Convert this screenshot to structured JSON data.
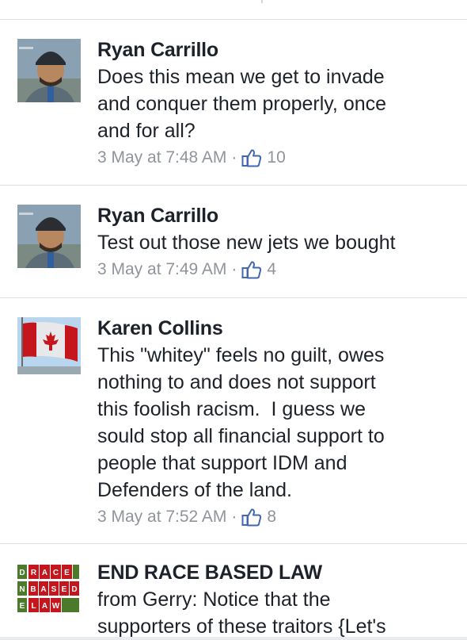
{
  "comments": [
    {
      "name": "Ryan Carrillo",
      "text": "Does this mean we get to invade\nand conquer them properly, once\nand for all?",
      "time": "3 May at 7:48 AM",
      "sep": "·",
      "likes": "10",
      "avatar": "man-beanie-avatar"
    },
    {
      "name": "Ryan Carrillo",
      "text": "Test out those new jets we bought",
      "time": "3 May at 7:49 AM",
      "sep": "·",
      "likes": "4",
      "avatar": "man-beanie-avatar"
    },
    {
      "name": "Karen Collins",
      "text": "This \"whitey\" feels no guilt, owes\nnothing to and does not support\nthis foolish racism.  I guess we\nsould stop all financial support to\npeople that support IDM and\nDefenders of the land.",
      "time": "3 May at 7:52 AM",
      "sep": "·",
      "likes": "8",
      "avatar": "canada-flag-avatar"
    },
    {
      "name": "END RACE BASED LAW",
      "text": "from Gerry: Notice that the\nsupporters of these traitors {Let's",
      "avatar": "end-race-based-law-logo",
      "logo": {
        "col": [
          "E",
          "N",
          "D"
        ],
        "row1": [
          "R",
          "A",
          "C",
          "E"
        ],
        "row2": [
          "B",
          "A",
          "S",
          "E",
          "D"
        ],
        "row3": [
          "L",
          "A",
          "W"
        ]
      }
    }
  ],
  "colors": {
    "name": "#1d2129",
    "meta": "#90949c",
    "like_icon": "#4267b2",
    "logo_red": "#c4161c",
    "logo_green": "#4a7a2a"
  }
}
